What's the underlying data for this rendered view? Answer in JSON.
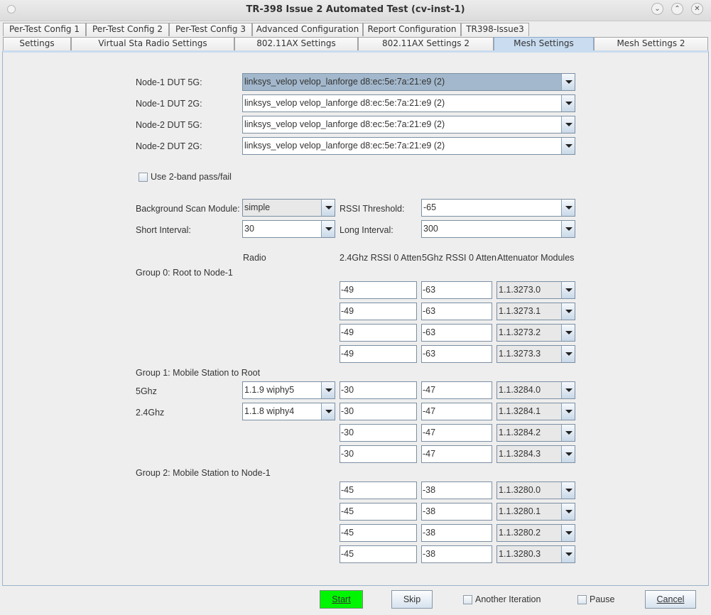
{
  "window": {
    "title": "TR-398 Issue 2 Automated Test  (cv-inst-1)",
    "controls": [
      "minimize",
      "maximize",
      "close"
    ]
  },
  "tabs": {
    "row1": [
      "Per-Test Config 1",
      "Per-Test Config 2",
      "Per-Test Config 3",
      "Advanced Configuration",
      "Report Configuration",
      "TR398-Issue3"
    ],
    "row2": [
      "Settings",
      "Virtual Sta Radio Settings",
      "802.11AX Settings",
      "802.11AX Settings 2",
      "Mesh Settings",
      "Mesh Settings 2"
    ],
    "active": "Mesh Settings"
  },
  "dut": [
    {
      "label": "Node-1 DUT 5G:",
      "value": "linksys_velop velop_lanforge d8:ec:5e:7a:21:e9 (2)"
    },
    {
      "label": "Node-1 DUT 2G:",
      "value": "linksys_velop velop_lanforge d8:ec:5e:7a:21:e9 (2)"
    },
    {
      "label": "Node-2 DUT 5G:",
      "value": "linksys_velop velop_lanforge d8:ec:5e:7a:21:e9 (2)"
    },
    {
      "label": "Node-2 DUT 2G:",
      "value": "linksys_velop velop_lanforge d8:ec:5e:7a:21:e9 (2)"
    }
  ],
  "two_band": {
    "label": "Use 2-band pass/fail",
    "checked": false
  },
  "scan": {
    "bg_scan_label": "Background Scan Module:",
    "bg_scan_value": "simple",
    "rssi_label": "RSSI Threshold:",
    "rssi_value": "-65",
    "short_label": "Short Interval:",
    "short_value": "30",
    "long_label": "Long Interval:",
    "long_value": "300"
  },
  "headers": {
    "radio": "Radio",
    "rssi24": "2.4Ghz RSSI 0 Atten",
    "rssi5": "5Ghz RSSI 0 Atten",
    "atten": "Attenuator Modules"
  },
  "groups": [
    {
      "title": "Group 0: Root to Node-1",
      "radios": [],
      "rows": [
        {
          "rssi24": "-49",
          "rssi5": "-63",
          "module": "1.1.3273.0"
        },
        {
          "rssi24": "-49",
          "rssi5": "-63",
          "module": "1.1.3273.1"
        },
        {
          "rssi24": "-49",
          "rssi5": "-63",
          "module": "1.1.3273.2"
        },
        {
          "rssi24": "-49",
          "rssi5": "-63",
          "module": "1.1.3273.3"
        }
      ]
    },
    {
      "title": "Group 1: Mobile Station to Root",
      "radios": [
        {
          "label": "5Ghz",
          "value": "1.1.9 wiphy5"
        },
        {
          "label": "2.4Ghz",
          "value": "1.1.8 wiphy4"
        }
      ],
      "rows": [
        {
          "rssi24": "-30",
          "rssi5": "-47",
          "module": "1.1.3284.0"
        },
        {
          "rssi24": "-30",
          "rssi5": "-47",
          "module": "1.1.3284.1"
        },
        {
          "rssi24": "-30",
          "rssi5": "-47",
          "module": "1.1.3284.2"
        },
        {
          "rssi24": "-30",
          "rssi5": "-47",
          "module": "1.1.3284.3"
        }
      ]
    },
    {
      "title": "Group 2: Mobile Station to Node-1",
      "radios": [],
      "rows": [
        {
          "rssi24": "-45",
          "rssi5": "-38",
          "module": "1.1.3280.0"
        },
        {
          "rssi24": "-45",
          "rssi5": "-38",
          "module": "1.1.3280.1"
        },
        {
          "rssi24": "-45",
          "rssi5": "-38",
          "module": "1.1.3280.2"
        },
        {
          "rssi24": "-45",
          "rssi5": "-38",
          "module": "1.1.3280.3"
        }
      ]
    }
  ],
  "footer": {
    "start": "Start",
    "skip": "Skip",
    "another_iteration": "Another Iteration",
    "pause": "Pause",
    "cancel": "Cancel",
    "start_color": "#00f500"
  }
}
